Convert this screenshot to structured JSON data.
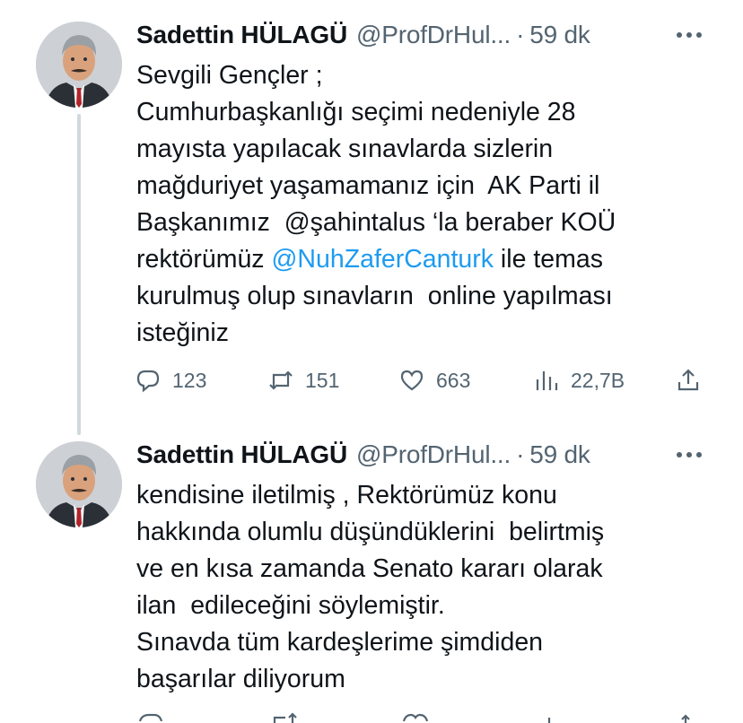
{
  "tweets": [
    {
      "author": {
        "name": "Sadettin HÜLAGÜ",
        "handle": "@ProfDrHul...",
        "separator": "·",
        "time": "59 dk",
        "avatar_icon": "profile-photo"
      },
      "text_lines": [
        "Sevgili Gençler ;",
        "Cumhurbaşkanlığı seçimi nedeniyle 28",
        "mayısta yapılacak sınavlarda sizlerin",
        "mağduriyet yaşamamanız için  AK Parti il",
        "Başkanımız  @şahintalus ‘la beraber KOÜ"
      ],
      "mention_line": {
        "before": "rektörümüz ",
        "mention": "@NuhZaferCanturk",
        "after": " ile temas"
      },
      "text_lines_after": [
        "kurulmuş olup sınavların  online yapılması",
        "isteğiniz"
      ],
      "actions": {
        "reply_count": "123",
        "retweet_count": "151",
        "like_count": "663",
        "views_count": "22,7B"
      }
    },
    {
      "author": {
        "name": "Sadettin HÜLAGÜ",
        "handle": "@ProfDrHul...",
        "separator": "·",
        "time": "59 dk",
        "avatar_icon": "profile-photo"
      },
      "text_lines": [
        "kendisine iletilmiş , Rektörümüz konu",
        "hakkında olumlu düşündüklerini  belirtmiş",
        "ve en kısa zamanda Senato kararı olarak",
        "ilan  edileceğini söylemiştir.",
        "Sınavda tüm kardeşlerime şimdiden",
        "başarılar diliyorum"
      ]
    }
  ],
  "colors": {
    "text": "#0f1419",
    "secondary": "#536471",
    "link": "#1d9bf0",
    "thread_line": "#cfd9de"
  }
}
